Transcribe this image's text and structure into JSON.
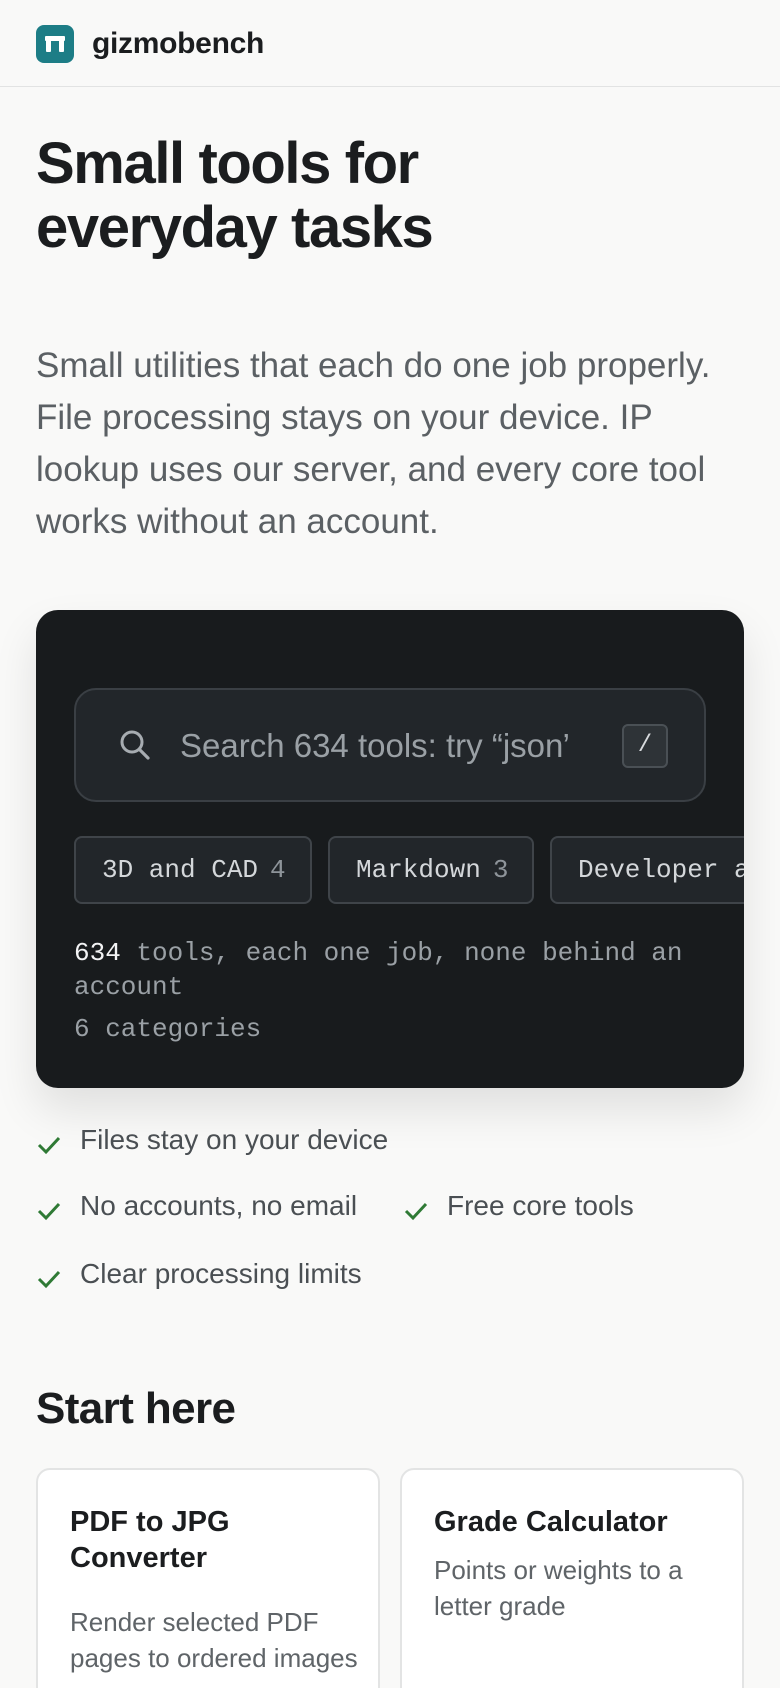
{
  "header": {
    "brand": "gizmobench",
    "logo_icon": "table-icon",
    "brand_color": "#1d7d86"
  },
  "hero": {
    "title_line1": "Small tools for",
    "title_line2": "everyday tasks",
    "subtitle": "Small utilities that each do one job properly. File processing stays on your device. IP lookup uses our server, and every core tool works without an account."
  },
  "search": {
    "placeholder": "Search 634 tools: try “json”",
    "shortcut": "/",
    "icon": "search-icon"
  },
  "categories": [
    {
      "label": "3D and CAD",
      "count": "4"
    },
    {
      "label": "Markdown",
      "count": "3"
    },
    {
      "label": "Developer and",
      "count": ""
    }
  ],
  "stats": {
    "tool_count": "634",
    "tools_text": " tools, each one job, none behind an account",
    "categories_text": "6 categories"
  },
  "features": [
    {
      "text": "Files stay on your device"
    },
    {
      "text": "No accounts, no email"
    },
    {
      "text": "Free core tools"
    },
    {
      "text": "Clear processing limits"
    }
  ],
  "feature_check_color": "#2f7a35",
  "start_here": {
    "title": "Start here",
    "cards": [
      {
        "title": "PDF to JPG Converter",
        "description": "Render selected PDF pages to ordered images"
      },
      {
        "title": "Grade Calculator",
        "description": "Points or weights to a letter grade"
      }
    ]
  }
}
